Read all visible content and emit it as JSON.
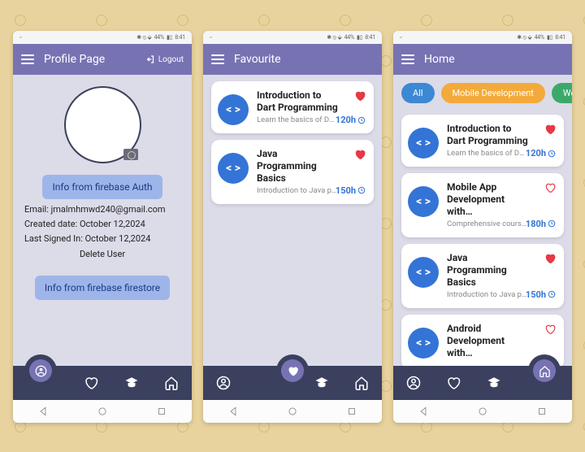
{
  "status": {
    "battery": "44%",
    "time": "8:41"
  },
  "profile": {
    "app_title": "Profile Page",
    "logout": "Logout",
    "info_auth": "Info from firebase Auth",
    "email_row": "Email: jmalmhmwd240@gmail.com",
    "created_row": "Created date: October 12,2024",
    "signed_row": "Last Signed In: October 12,2024",
    "delete": "Delete User",
    "info_firestore": "Info from firebase firestore"
  },
  "favourite": {
    "app_title": "Favourite",
    "cards": [
      {
        "title": "Introduction to Dart Programming",
        "desc": "Learn the basics of Dart programming language …",
        "hours": "120h",
        "fav": true
      },
      {
        "title": "Java Programming Basics",
        "desc": "Introduction to Java programming and its va…",
        "hours": "150h",
        "fav": true
      }
    ]
  },
  "home": {
    "app_title": "Home",
    "chips": [
      "All",
      "Mobile Development",
      "Web Dev"
    ],
    "cards": [
      {
        "title": "Introduction to Dart Programming",
        "desc": "Learn the basics of Dart programming language …",
        "hours": "120h",
        "fav": true
      },
      {
        "title": "Mobile App Development with…",
        "desc": "Comprehensive course on how to build mobile …",
        "hours": "180h",
        "fav": false
      },
      {
        "title": "Java Programming Basics",
        "desc": "Introduction to Java programming and its va…",
        "hours": "150h",
        "fav": true
      },
      {
        "title": "Android Development with…",
        "desc": "",
        "hours": "",
        "fav": false
      }
    ]
  }
}
